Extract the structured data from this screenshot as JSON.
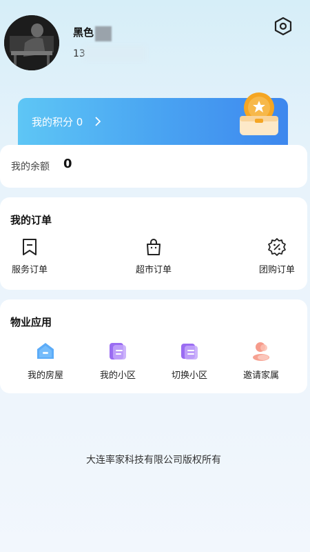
{
  "profile": {
    "name": "黑色",
    "phone": "13",
    "avatar_icon": "avatar-photo"
  },
  "settings_icon": "hexagon-settings-icon",
  "points": {
    "label": "我的积分 0",
    "chevron": ">",
    "icon": "treasure-chest-star-icon"
  },
  "balance": {
    "label": "我的余额",
    "value": "0"
  },
  "orders": {
    "title": "我的订单",
    "items": [
      {
        "label": "服务订单",
        "icon": "bookmark-icon"
      },
      {
        "label": "超市订单",
        "icon": "shopping-bag-icon"
      },
      {
        "label": "团购订单",
        "icon": "discount-badge-icon"
      }
    ]
  },
  "property_apps": {
    "title": "物业应用",
    "items": [
      {
        "label": "我的房屋",
        "icon": "house-icon",
        "color": "#4aa3f7"
      },
      {
        "label": "我的小区",
        "icon": "community-icon",
        "color": "#9a6cf2"
      },
      {
        "label": "切换小区",
        "icon": "switch-community-icon",
        "color": "#9a6cf2"
      },
      {
        "label": "邀请家属",
        "icon": "invite-family-icon",
        "color": "#f5907e"
      }
    ]
  },
  "footer": {
    "copyright": "大连率家科技有限公司版权所有"
  },
  "colors": {
    "banner_start": "#5ec6f5",
    "banner_end": "#3d87ee",
    "accent_orange": "#f5a623"
  }
}
